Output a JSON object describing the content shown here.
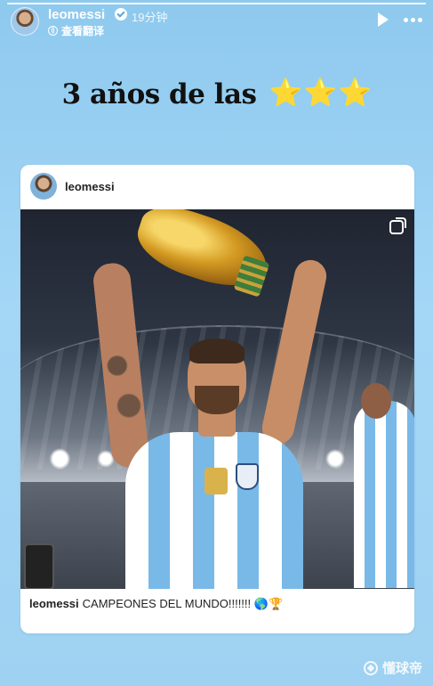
{
  "story": {
    "username": "leomessi",
    "time": "19分钟",
    "translate_label": "查看翻译"
  },
  "headline": {
    "text": "3 años de las",
    "stars": [
      "⭐",
      "⭐",
      "⭐"
    ]
  },
  "card": {
    "username": "leomessi",
    "caption_user": "leomessi",
    "caption_text": "CAMPEONES DEL MUNDO!!!!!!! 🌎🏆"
  },
  "watermark": {
    "text": "懂球帝"
  },
  "colors": {
    "background": "#9fd2f2",
    "jersey_blue": "#79b9e8",
    "star": "#f2c230"
  },
  "icons": [
    "verified-icon",
    "globe-icon",
    "play-icon",
    "more-icon",
    "multi-photo-icon",
    "ball-icon"
  ]
}
